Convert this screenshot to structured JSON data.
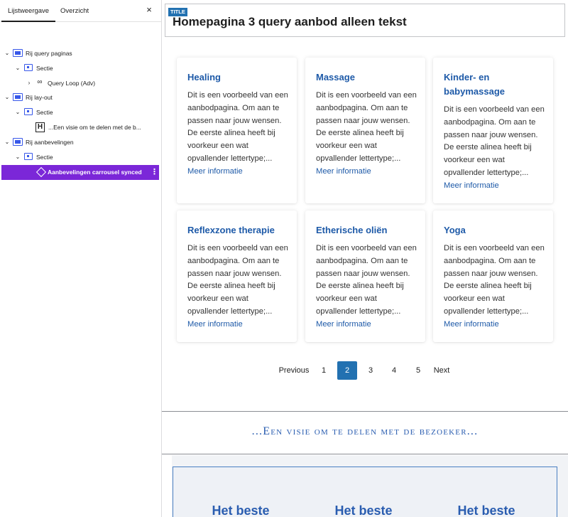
{
  "panel": {
    "tabs": [
      "Lijstweergave",
      "Overzicht"
    ],
    "close_glyph": "×",
    "tree": [
      {
        "label": "Rij query paginas",
        "icon": "row-icon",
        "level": 0,
        "expanded": true
      },
      {
        "label": "Sectie",
        "icon": "section-icon",
        "level": 1,
        "expanded": true
      },
      {
        "label": "Query Loop (Adv)",
        "icon": "loop-icon",
        "level": 2,
        "expanded": false
      },
      {
        "label": "Rij lay-out",
        "icon": "row-icon",
        "level": 0,
        "expanded": true
      },
      {
        "label": "Sectie",
        "icon": "section-icon",
        "level": 1,
        "expanded": true
      },
      {
        "label": "...Een visie om te delen met de b...",
        "icon": "heading-icon",
        "level": 2
      },
      {
        "label": "Rij aanbevelingen",
        "icon": "row-icon",
        "level": 0,
        "expanded": true
      },
      {
        "label": "Sectie",
        "icon": "section-icon",
        "level": 1,
        "expanded": true
      },
      {
        "label": "Aanbevelingen carrousel synced",
        "icon": "synced-pattern-icon",
        "level": 2,
        "selected": true
      }
    ]
  },
  "canvas": {
    "title_tag": "TITLE",
    "title": "Homepagina 3 query aanbod alleen tekst",
    "cards": [
      {
        "title": "Healing",
        "excerpt": "Dit is een voorbeeld van een aanbodpagina. Om aan te passen naar jouw wensen. De eerste alinea heeft bij voorkeur een wat opvallender lettertype;...",
        "link": "Meer informatie"
      },
      {
        "title": "Massage",
        "excerpt": "Dit is een voorbeeld van een aanbodpagina. Om aan te passen naar jouw wensen. De eerste alinea heeft bij voorkeur een wat opvallender lettertype;...",
        "link": "Meer informatie"
      },
      {
        "title": "Kinder- en babymassage",
        "excerpt": "Dit is een voorbeeld van een aanbodpagina. Om aan te passen naar jouw wensen. De eerste alinea heeft bij voorkeur een wat opvallender lettertype;...",
        "link": "Meer informatie"
      },
      {
        "title": "Reflexzone therapie",
        "excerpt": "Dit is een voorbeeld van een aanbodpagina. Om aan te passen naar jouw wensen. De eerste alinea heeft bij voorkeur een wat opvallender lettertype;...",
        "link": "Meer informatie"
      },
      {
        "title": "Etherische oliën",
        "excerpt": "Dit is een voorbeeld van een aanbodpagina. Om aan te passen naar jouw wensen. De eerste alinea heeft bij voorkeur een wat opvallender lettertype;...",
        "link": "Meer informatie"
      },
      {
        "title": "Yoga",
        "excerpt": "Dit is een voorbeeld van een aanbodpagina. Om aan te passen naar jouw wensen. De eerste alinea heeft bij voorkeur een wat opvallender lettertype;...",
        "link": "Meer informatie"
      }
    ],
    "pagination": {
      "previous": "Previous",
      "pages": [
        "1",
        "2",
        "3",
        "4",
        "5"
      ],
      "current": "2",
      "next": "Next"
    },
    "vision_heading": "...Een visie om te delen met de bezoeker...",
    "testimonial_titles": [
      "Het beste",
      "Het beste",
      "Het beste"
    ],
    "colors": {
      "link": "#1e5aa8",
      "selection": "#7b27d8",
      "accent": "#2271b1"
    }
  }
}
